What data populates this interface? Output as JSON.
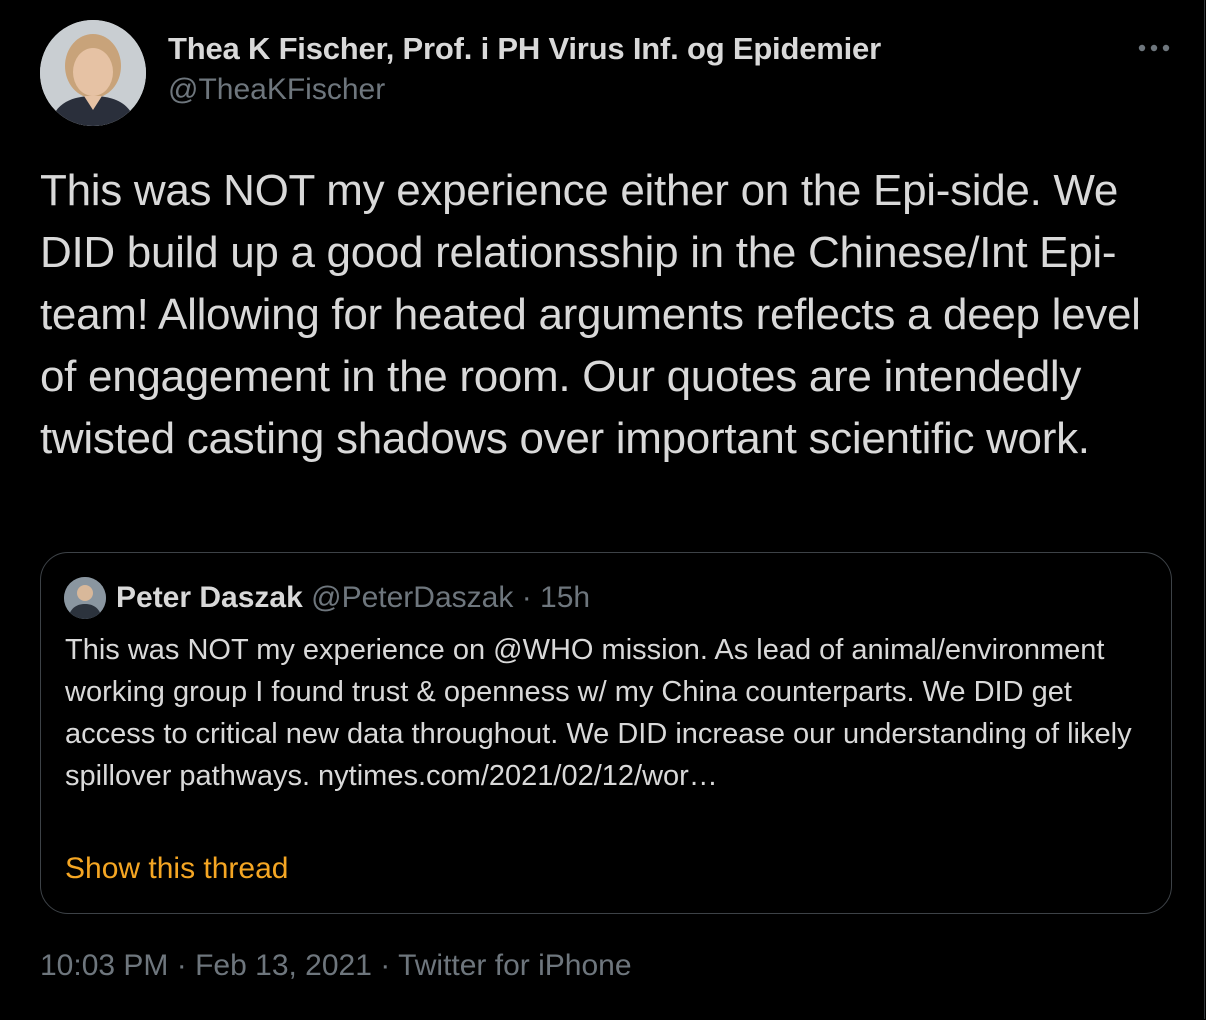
{
  "tweet": {
    "author_name": "Thea K Fischer, Prof. i PH Virus Inf. og Epidemier",
    "author_handle": "@TheaKFischer",
    "text": "This was NOT my experience either on the Epi-side. We DID build up a good relationsship in the Chinese/Int Epi-team! Allowing for heated arguments reflects a deep level of engagement in the room. Our quotes are intendedly twisted casting shadows over important scientific work.",
    "more_icon": "more-horizontal-icon",
    "timestamp_time": "10:03 PM",
    "separator": "·",
    "timestamp_date": "Feb 13, 2021",
    "source_app": "Twitter for iPhone"
  },
  "quoted": {
    "author_name": "Peter Daszak",
    "author_handle": "@PeterDaszak",
    "separator": "·",
    "time_ago": "15h",
    "text": "This was NOT my experience on @WHO mission. As lead of animal/environment working group I found trust & openness w/ my China counterparts. We DID get access to critical new data throughout. We DID increase our understanding of likely spillover pathways. nytimes.com/2021/02/12/wor…",
    "show_thread_label": "Show this thread"
  },
  "colors": {
    "background": "#000000",
    "text_primary": "#d9d9d9",
    "text_secondary": "#6e767d",
    "accent_link": "#f5a623",
    "border": "#3d4247"
  }
}
